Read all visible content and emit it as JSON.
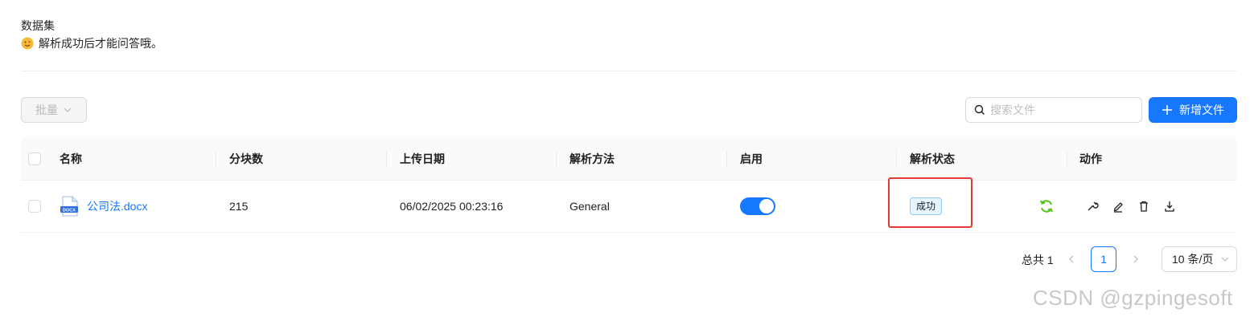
{
  "header": {
    "title": "数据集",
    "subtitle": "解析成功后才能问答哦。"
  },
  "toolbar": {
    "batch_label": "批量",
    "search_placeholder": "搜索文件",
    "add_label": "新增文件"
  },
  "table": {
    "columns": [
      "名称",
      "分块数",
      "上传日期",
      "解析方法",
      "启用",
      "解析状态",
      "动作"
    ],
    "rows": [
      {
        "name": "公司法.docx",
        "file_badge": "DOCX",
        "chunks": "215",
        "upload_date": "06/02/2025 00:23:16",
        "parse_method": "General",
        "enabled": true,
        "status": "成功"
      }
    ]
  },
  "pagination": {
    "total": "总共 1",
    "current_page": "1",
    "page_size": "10 条/页"
  },
  "watermark": "CSDN @gzpingesoft",
  "colors": {
    "primary": "#1677ff",
    "success": "#52c41a",
    "highlight": "#e53935"
  }
}
